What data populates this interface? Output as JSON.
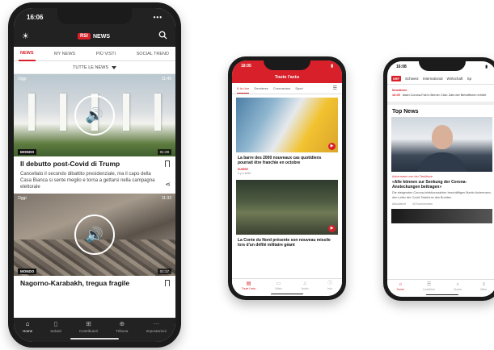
{
  "phone1": {
    "status": {
      "time": "16:06",
      "signal": "•••"
    },
    "app": {
      "logo_badge": "RSI",
      "logo_text": "NEWS"
    },
    "tabs": [
      {
        "label": "NEWS"
      },
      {
        "label": "MY NEWS"
      },
      {
        "label": "PIÙ VISTI"
      },
      {
        "label": "SOCIAL TREND"
      }
    ],
    "filter_label": "TUTTE LE NEWS",
    "articles": [
      {
        "img_tag": "Oggi",
        "img_time": "11:45",
        "category": "MONDO",
        "duration": "01:29",
        "title": "Il debutto post-Covid di Trump",
        "desc": "Cancellato il secondo dibattito presidenziale, ma il capo della Casa Bianca si sente meglio e torna a gettarsi nella campagna elettorale"
      },
      {
        "img_tag": "Oggi",
        "img_time": "11:32",
        "category": "MONDO",
        "duration": "01:17",
        "title": "Nagorno-Karabakh, tregua fragile"
      }
    ],
    "nav": [
      {
        "label": "Home"
      },
      {
        "label": "Salvati"
      },
      {
        "label": "Contributori"
      },
      {
        "label": "Tribuna"
      },
      {
        "label": "Impostazioni"
      }
    ]
  },
  "phone2": {
    "status": {
      "time": "18:05"
    },
    "header_title": "Toute l'actu",
    "tabs": [
      {
        "label": "À la Une"
      },
      {
        "label": "Dernières"
      },
      {
        "label": "Coronavirus"
      },
      {
        "label": "Sport"
      }
    ],
    "articles": [
      {
        "title": "La barre des 2000 nouveaux cas quotidiens pourrait être franchie en octobre",
        "source": "SUISSE",
        "meta": "Il y a 1h50"
      },
      {
        "title": "La Corée du Nord présente son nouveau missile lors d'un défilé militaire géant"
      }
    ],
    "nav": [
      {
        "label": "Toute l'actu"
      },
      {
        "label": "Vidéo"
      },
      {
        "label": "Audio"
      },
      {
        "label": "Info"
      }
    ]
  },
  "phone3": {
    "status": {
      "time": "16:08"
    },
    "logo": "SRF",
    "tabs": [
      {
        "label": "Schweiz"
      },
      {
        "label": "International"
      },
      {
        "label": "Wirtschaft"
      },
      {
        "label": "Sp"
      }
    ],
    "ticker_label": "Newsticker",
    "ticker_time": "16:05",
    "ticker_text": "Nach Corona-Fall in Berner Club: Zahl der Betroffenen erhöht",
    "section_title": "Top News",
    "article": {
      "kicker": "Ackermann von der Taskforce",
      "title": "«Alle können zur Senkung der Corona-Ansteckungen beitragen»",
      "desc": "Die steigenden Corona-Infektionszahlen beschäftigen Martin Ackermann, den Leiter der Covid-Taskforce des Bundes.",
      "meta_time": "Aktualisiert",
      "meta_count": "45 Kommentare"
    },
    "nav": [
      {
        "label": "Home"
      },
      {
        "label": "Liveticker"
      },
      {
        "label": "Suche"
      },
      {
        "label": "Mehr"
      }
    ]
  }
}
